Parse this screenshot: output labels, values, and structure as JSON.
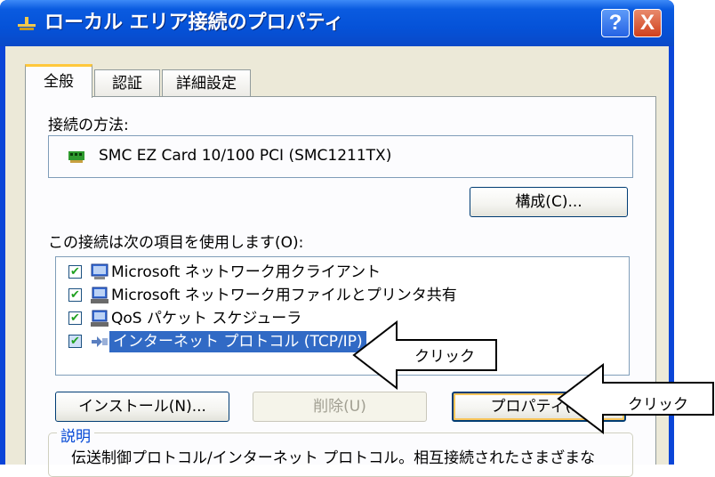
{
  "window": {
    "title": "ローカル エリア接続のプロパティ",
    "help_button": "?",
    "close_button": "X"
  },
  "tabs": [
    {
      "label": "全般",
      "active": true
    },
    {
      "label": "認証",
      "active": false
    },
    {
      "label": "詳細設定",
      "active": false
    }
  ],
  "connection": {
    "method_label": "接続の方法:",
    "device_name": "SMC EZ Card 10/100 PCI (SMC1211TX)",
    "configure_button": "構成(C)..."
  },
  "items": {
    "label": "この接続は次の項目を使用します(O):",
    "list": [
      {
        "label": "Microsoft ネットワーク用クライアント",
        "checked": true,
        "icon": "network-client-icon",
        "selected": false
      },
      {
        "label": "Microsoft ネットワーク用ファイルとプリンタ共有",
        "checked": true,
        "icon": "file-printer-sharing-icon",
        "selected": false
      },
      {
        "label": "QoS パケット スケジューラ",
        "checked": true,
        "icon": "qos-scheduler-icon",
        "selected": false
      },
      {
        "label": "インターネット プロトコル (TCP/IP)",
        "checked": true,
        "icon": "protocol-icon",
        "selected": true
      }
    ]
  },
  "buttons": {
    "install": "インストール(N)...",
    "uninstall": "削除(U)",
    "properties": "プロパティ(R)"
  },
  "description": {
    "label": "説明",
    "text": "伝送制御プロトコル/インターネット プロトコル。相互接続されたさまざまな"
  },
  "annotations": [
    {
      "label": "クリック"
    },
    {
      "label": "クリック"
    }
  ],
  "colors": {
    "titlebar": "#0552d8",
    "client": "#ece9d8",
    "selection": "#316ac5",
    "tab_highlight": "#ffc83c",
    "close": "#d0401c"
  }
}
